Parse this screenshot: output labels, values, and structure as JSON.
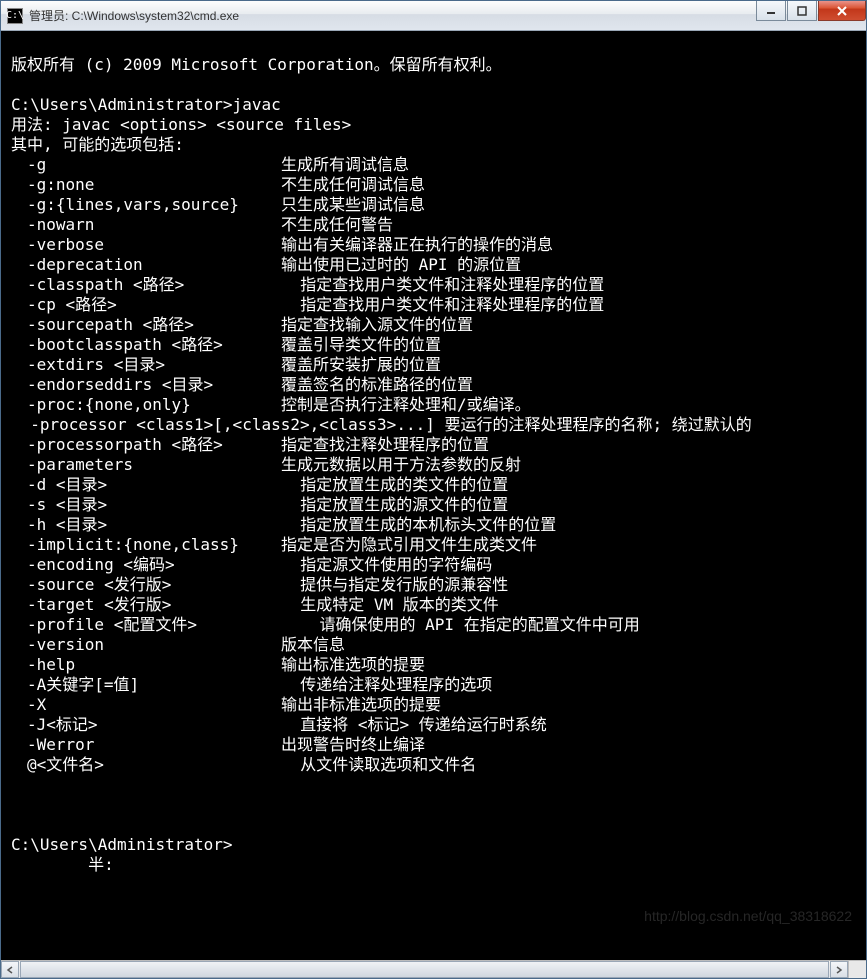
{
  "window": {
    "title": "管理员: C:\\Windows\\system32\\cmd.exe",
    "icon_label": "cmd-icon"
  },
  "copyright": "版权所有 (c) 2009 Microsoft Corporation。保留所有权利。",
  "prompt1": "C:\\Users\\Administrator>javac",
  "usage": "用法: javac <options> <source files>",
  "where": "其中, 可能的选项包括:",
  "options": [
    {
      "flag": "-g",
      "desc": "生成所有调试信息"
    },
    {
      "flag": "-g:none",
      "desc": "不生成任何调试信息"
    },
    {
      "flag": "-g:{lines,vars,source}",
      "desc": "只生成某些调试信息"
    },
    {
      "flag": "-nowarn",
      "desc": "不生成任何警告"
    },
    {
      "flag": "-verbose",
      "desc": "输出有关编译器正在执行的操作的消息"
    },
    {
      "flag": "-deprecation",
      "desc": "输出使用已过时的 API 的源位置"
    },
    {
      "flag": "-classpath <路径>",
      "desc": "  指定查找用户类文件和注释处理程序的位置"
    },
    {
      "flag": "-cp <路径>",
      "desc": "  指定查找用户类文件和注释处理程序的位置"
    },
    {
      "flag": "-sourcepath <路径>",
      "desc": "指定查找输入源文件的位置"
    },
    {
      "flag": "-bootclasspath <路径>",
      "desc": "覆盖引导类文件的位置"
    },
    {
      "flag": "-extdirs <目录>",
      "desc": "覆盖所安装扩展的位置"
    },
    {
      "flag": "-endorseddirs <目录>",
      "desc": "覆盖签名的标准路径的位置"
    },
    {
      "flag": "-proc:{none,only}",
      "desc": "控制是否执行注释处理和/或编译。"
    }
  ],
  "processor_line": "  -processor <class1>[,<class2>,<class3>...] 要运行的注释处理程序的名称; 绕过默认的",
  "options2": [
    {
      "flag": "-processorpath <路径>",
      "desc": "指定查找注释处理程序的位置"
    },
    {
      "flag": "-parameters",
      "desc": "生成元数据以用于方法参数的反射"
    },
    {
      "flag": "-d <目录>",
      "desc": "  指定放置生成的类文件的位置"
    },
    {
      "flag": "-s <目录>",
      "desc": "  指定放置生成的源文件的位置"
    },
    {
      "flag": "-h <目录>",
      "desc": "  指定放置生成的本机标头文件的位置"
    },
    {
      "flag": "-implicit:{none,class}",
      "desc": "指定是否为隐式引用文件生成类文件"
    },
    {
      "flag": "-encoding <编码>",
      "desc": "  指定源文件使用的字符编码"
    },
    {
      "flag": "-source <发行版>",
      "desc": "  提供与指定发行版的源兼容性"
    },
    {
      "flag": "-target <发行版>",
      "desc": "  生成特定 VM 版本的类文件"
    },
    {
      "flag": "-profile <配置文件>",
      "desc": "    请确保使用的 API 在指定的配置文件中可用"
    },
    {
      "flag": "-version",
      "desc": "版本信息"
    },
    {
      "flag": "-help",
      "desc": "输出标准选项的提要"
    },
    {
      "flag": "-A关键字[=值]",
      "desc": "  传递给注释处理程序的选项"
    },
    {
      "flag": "-X",
      "desc": "输出非标准选项的提要"
    },
    {
      "flag": "-J<标记>",
      "desc": "  直接将 <标记> 传递给运行时系统"
    },
    {
      "flag": "-Werror",
      "desc": "出现警告时终止编译"
    },
    {
      "flag": "@<文件名>",
      "desc": "  从文件读取选项和文件名"
    }
  ],
  "prompt2": "C:\\Users\\Administrator>",
  "ime": "        半:",
  "watermark": "http://blog.csdn.net/qq_38318622"
}
